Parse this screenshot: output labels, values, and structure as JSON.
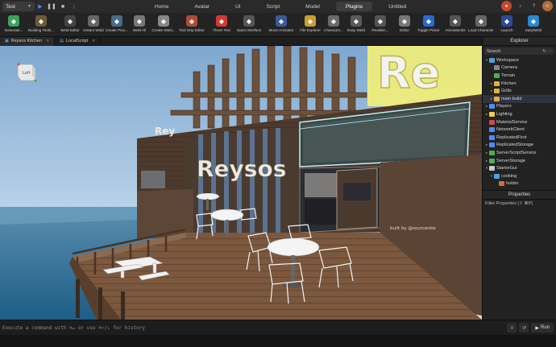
{
  "menubar": {
    "place": "Test",
    "tabs": [
      {
        "label": "Home",
        "active": false
      },
      {
        "label": "Avatar",
        "active": false
      },
      {
        "label": "UI",
        "active": false
      },
      {
        "label": "Script",
        "active": false
      },
      {
        "label": "Model",
        "active": false
      },
      {
        "label": "Plugins",
        "active": true
      },
      {
        "label": "Untitled",
        "active": false
      }
    ]
  },
  "ribbon": {
    "tools": [
      {
        "label": "Generate...",
        "icon": "generate-icon",
        "color": "#3aa35a"
      },
      {
        "label": "Building Tools...",
        "icon": "building-tools-icon",
        "color": "#6b5a3a"
      },
      {
        "label": "Weld Editor",
        "icon": "weld-editor-icon",
        "color": "#444"
      },
      {
        "label": "Instant Weld",
        "icon": "instant-weld-icon",
        "color": "#666"
      },
      {
        "label": "Create Pivo...",
        "icon": "pivot-icon",
        "color": "#4a6a8a"
      },
      {
        "label": "Weld All",
        "icon": "weld-all-icon",
        "color": "#777"
      },
      {
        "label": "Create Weld...",
        "icon": "create-weld-icon",
        "color": "#888"
      },
      {
        "label": "Tool Grip Editor",
        "icon": "tool-grip-icon",
        "color": "#b04a3a"
      },
      {
        "label": "Three Text",
        "icon": "three-text-icon",
        "color": "#d23a3a"
      },
      {
        "label": "Open Interface",
        "icon": "open-interface-icon",
        "color": "#555"
      },
      {
        "label": "Moon Animator",
        "icon": "moon-animator-icon",
        "color": "#3a5a9a"
      },
      {
        "label": "File Explorer",
        "icon": "file-explorer-icon",
        "color": "#c9a030"
      },
      {
        "label": "Character...",
        "icon": "character-icon",
        "color": "#6a6a6a"
      },
      {
        "label": "Easy Weld",
        "icon": "easy-weld-icon",
        "color": "#5a5a5a"
      },
      {
        "label": "Realistic...",
        "icon": "realistic-icon",
        "color": "#555"
      },
      {
        "label": "Editor",
        "icon": "editor-icon",
        "color": "#777"
      },
      {
        "label": "Toggle Picker",
        "icon": "toggle-picker-icon",
        "color": "#2a6ad0"
      },
      {
        "label": "AnimationID",
        "icon": "animation-id-icon",
        "color": "#555"
      },
      {
        "label": "Load Character",
        "icon": "load-character-icon",
        "color": "#666"
      },
      {
        "label": "Launch",
        "icon": "launch-icon",
        "color": "#2a4a9a"
      },
      {
        "label": "easyWeld",
        "icon": "easyweld-icon",
        "color": "#2a8ad0"
      }
    ]
  },
  "doctabs": [
    {
      "label": "Reysos Kitchen",
      "active": true
    },
    {
      "label": "LocalScript",
      "active": false
    }
  ],
  "viewport": {
    "viewcube_label": "Left",
    "sign_text": "Reysos",
    "roof_text": "Re",
    "credit_text": "built by @sourcenite"
  },
  "explorer": {
    "title": "Explorer",
    "search_placeholder": "Search",
    "items": [
      {
        "label": "Workspace",
        "depth": 0,
        "arrow": "▾",
        "icon": "workspace-icon",
        "color": "#4aa3df"
      },
      {
        "label": "Camera",
        "depth": 1,
        "arrow": "",
        "icon": "camera-icon",
        "color": "#888"
      },
      {
        "label": "Terrain",
        "depth": 1,
        "arrow": "",
        "icon": "terrain-icon",
        "color": "#4caf50"
      },
      {
        "label": "Kitchen",
        "depth": 1,
        "arrow": "▸",
        "icon": "folder-icon",
        "color": "#e0b040"
      },
      {
        "label": "Grills",
        "depth": 1,
        "arrow": "▸",
        "icon": "folder-icon",
        "color": "#e0b040"
      },
      {
        "label": "main build",
        "depth": 1,
        "arrow": "▸",
        "icon": "folder-icon",
        "color": "#e0b040"
      },
      {
        "label": "Players",
        "depth": 0,
        "arrow": "▸",
        "icon": "players-icon",
        "color": "#4a8cff"
      },
      {
        "label": "Lighting",
        "depth": 0,
        "arrow": "▸",
        "icon": "lighting-icon",
        "color": "#f0d040"
      },
      {
        "label": "MaterialService",
        "depth": 0,
        "arrow": "",
        "icon": "material-icon",
        "color": "#d04a4a"
      },
      {
        "label": "NetworkClient",
        "depth": 0,
        "arrow": "",
        "icon": "network-icon",
        "color": "#4a8cff"
      },
      {
        "label": "ReplicatedFirst",
        "depth": 0,
        "arrow": "",
        "icon": "replicated-first-icon",
        "color": "#4a8cff"
      },
      {
        "label": "ReplicatedStorage",
        "depth": 0,
        "arrow": "▸",
        "icon": "replicated-storage-icon",
        "color": "#4a8cff"
      },
      {
        "label": "ServerScriptService",
        "depth": 0,
        "arrow": "▸",
        "icon": "server-script-icon",
        "color": "#4caf50"
      },
      {
        "label": "ServerStorage",
        "depth": 0,
        "arrow": "▸",
        "icon": "server-storage-icon",
        "color": "#4caf50"
      },
      {
        "label": "StarterGui",
        "depth": 0,
        "arrow": "▾",
        "icon": "starter-gui-icon",
        "color": "#c8c8c8"
      },
      {
        "label": "cooking",
        "depth": 1,
        "arrow": "▾",
        "icon": "screen-gui-icon",
        "color": "#4aa3df"
      },
      {
        "label": "holder",
        "depth": 2,
        "arrow": "",
        "icon": "frame-icon",
        "color": "#d86a3a"
      }
    ]
  },
  "properties": {
    "title": "Properties",
    "filter_placeholder": "Filter Properties (⇧ ⌘P)"
  },
  "commandbar": {
    "placeholder": "Execute a command with ⌘↵ or use ⌘↑/↓ for history",
    "run_label": "Run"
  }
}
